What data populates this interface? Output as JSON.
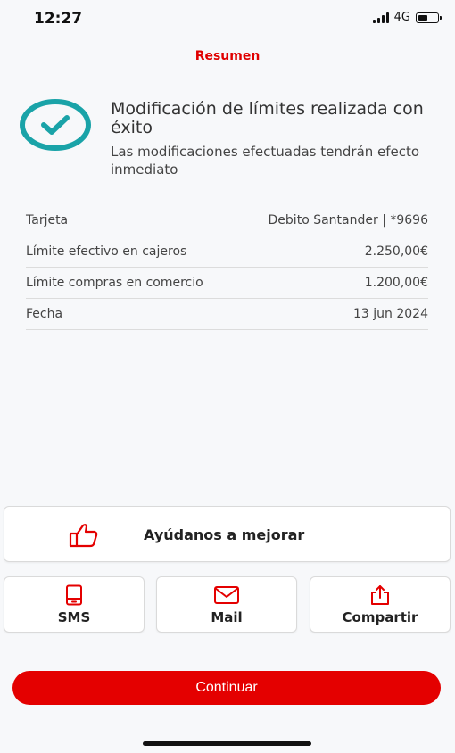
{
  "status_bar": {
    "time": "12:27",
    "network": "4G",
    "battery_level": 0.55
  },
  "header": {
    "title": "Resumen"
  },
  "success": {
    "title": "Modificación de límites realizada con éxito",
    "subtitle": "Las modificaciones efectuadas tendrán efecto inmediato",
    "icon": "check-circle-icon",
    "accent_color": "#1aa3a8"
  },
  "summary": [
    {
      "label": "Tarjeta",
      "value": "Debito Santander | *9696"
    },
    {
      "label": "Límite efectivo en cajeros",
      "value": "2.250,00€"
    },
    {
      "label": "Límite compras en comercio",
      "value": "1.200,00€"
    },
    {
      "label": "Fecha",
      "value": "13 jun 2024"
    }
  ],
  "feedback": {
    "label": "Ayúdanos a mejorar",
    "icon": "thumbs-up-icon"
  },
  "actions": [
    {
      "label": "SMS",
      "icon": "phone-icon"
    },
    {
      "label": "Mail",
      "icon": "mail-icon"
    },
    {
      "label": "Compartir",
      "icon": "share-icon"
    }
  ],
  "continue_label": "Continuar",
  "colors": {
    "brand": "#e40000",
    "success": "#1aa3a8"
  }
}
